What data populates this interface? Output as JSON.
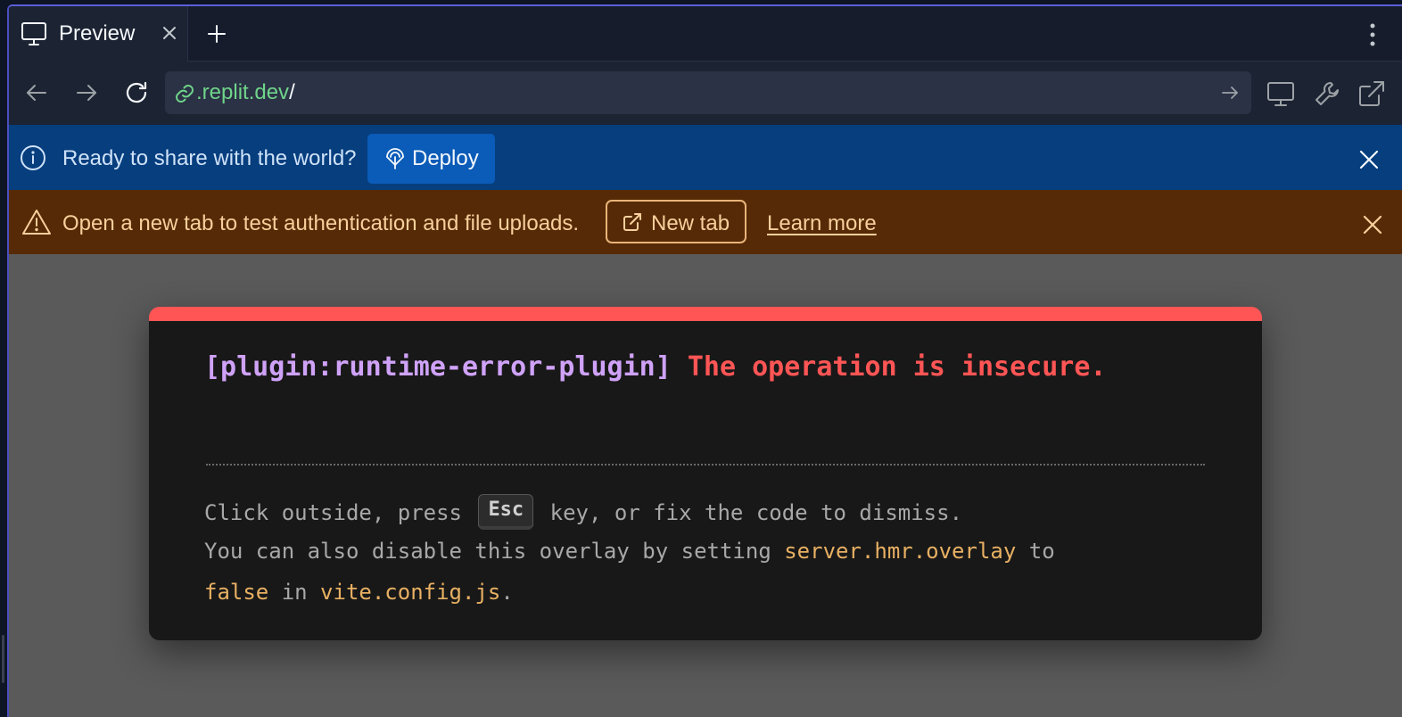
{
  "tabbar": {
    "tab_title": "Preview"
  },
  "navbar": {
    "url_host": ".replit.dev",
    "url_path": "/"
  },
  "deploy_banner": {
    "message": "Ready to share with the world?",
    "deploy_label": "Deploy"
  },
  "warn_banner": {
    "message": "Open a new tab to test authentication and file uploads.",
    "new_tab_label": "New tab",
    "learn_more_label": "Learn more"
  },
  "error_overlay": {
    "plugin": "[plugin:runtime-error-plugin]",
    "message": "The operation is insecure.",
    "tip1_before": "Click outside, press ",
    "tip1_key": "Esc",
    "tip1_after": " key, or fix the code to dismiss.",
    "tip2_before": "You can also disable this overlay by setting ",
    "tip2_code": "server.hmr.overlay",
    "tip2_after": " to",
    "tip3_code1": "false",
    "tip3_middle": " in ",
    "tip3_code2": "vite.config.js",
    "tip3_after": "."
  },
  "colors": {
    "accent_border": "#5b5fd6",
    "deploy_banner_bg": "#063e7e",
    "warn_banner_bg": "#562a06",
    "error_red": "#ff5555",
    "plugin_purple": "#cfa2f8",
    "code_orange": "#e7b063",
    "url_green": "#6fd48a"
  },
  "icons": [
    "monitor-icon",
    "close-icon",
    "plus-icon",
    "kebab-icon",
    "back-arrow-icon",
    "forward-arrow-icon",
    "reload-icon",
    "link-icon",
    "go-arrow-icon",
    "devices-icon",
    "wrench-icon",
    "external-link-icon",
    "info-icon",
    "deploy-icon",
    "warning-icon"
  ]
}
